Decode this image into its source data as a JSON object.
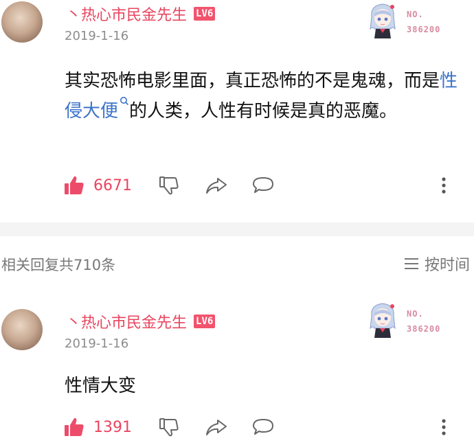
{
  "main_comment": {
    "username": "丶热心市民金先生",
    "level": "LV6",
    "date": "2019-1-16",
    "badge": {
      "label": "NO.",
      "number": "386200"
    },
    "text_before": "其实恐怖电影里面，真正恐怖的不是鬼魂，而是",
    "text_link": "性侵大便",
    "text_after": "的人类，人性有时候是真的恶魔。",
    "likes": "6671"
  },
  "replies_header": {
    "title": "相关回复共710条",
    "sort_label": "按时间"
  },
  "reply": {
    "username": "丶热心市民金先生",
    "level": "LV6",
    "date": "2019-1-16",
    "badge": {
      "label": "NO.",
      "number": "386200"
    },
    "text": "性情大变",
    "likes": "1391"
  },
  "icons": [
    "thumbs-up-icon",
    "thumbs-down-icon",
    "share-icon",
    "comment-icon",
    "more-icon",
    "search-icon",
    "sort-icon"
  ],
  "colors": {
    "accent": "#e8455f",
    "link": "#3b73c9",
    "muted": "#8c8c8c"
  }
}
